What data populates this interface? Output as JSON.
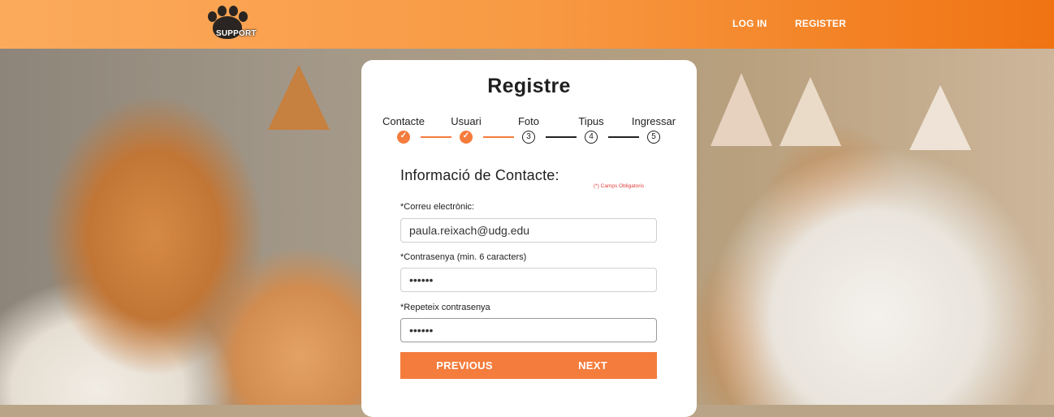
{
  "header": {
    "logo_text": "SUPPORT",
    "nav": [
      {
        "label": "LOG IN"
      },
      {
        "label": "REGISTER"
      }
    ]
  },
  "card": {
    "title": "Registre",
    "steps": [
      {
        "label": "Contacte",
        "status": "done",
        "number": "1"
      },
      {
        "label": "Usuari",
        "status": "done",
        "number": "2"
      },
      {
        "label": "Foto",
        "status": "todo",
        "number": "3"
      },
      {
        "label": "Tipus",
        "status": "todo",
        "number": "4"
      },
      {
        "label": "Ingressar",
        "status": "todo",
        "number": "5"
      }
    ],
    "section_title": "Informació de Contacte:",
    "required_note": "(*) Camps Obligatoris",
    "fields": [
      {
        "label": "*Correu electrònic:",
        "value": "paula.reixach@udg.edu"
      },
      {
        "label": "*Contrasenya (min. 6 caracters)",
        "value": "••••••"
      },
      {
        "label": "*Repeteix contrasenya",
        "value": "••••••"
      }
    ],
    "buttons": {
      "previous": "PREVIOUS",
      "next": "NEXT"
    }
  },
  "colors": {
    "accent": "#f47c3c",
    "header_start": "#fbaa5c",
    "header_end": "#f07312"
  }
}
